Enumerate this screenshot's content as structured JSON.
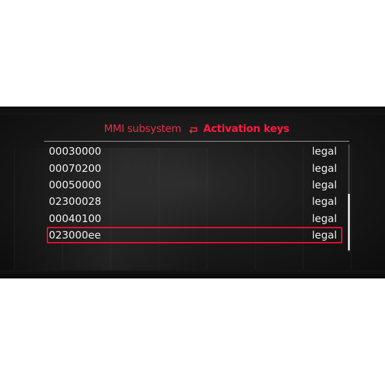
{
  "header": {
    "parent": "MMI subsystem",
    "current": "Activation keys"
  },
  "keys": [
    {
      "code": "00030000",
      "status": "legal"
    },
    {
      "code": "00070200",
      "status": "legal"
    },
    {
      "code": "00050000",
      "status": "legal"
    },
    {
      "code": "02300028",
      "status": "legal"
    },
    {
      "code": "00040100",
      "status": "legal"
    },
    {
      "code": "023000ee",
      "status": "legal"
    }
  ],
  "selected_index": 5,
  "colors": {
    "accent": "#ff1a3c",
    "selection_border": "#e8102e",
    "text": "#f2f2f2"
  },
  "icons": {
    "back": "back-arrow-icon"
  }
}
